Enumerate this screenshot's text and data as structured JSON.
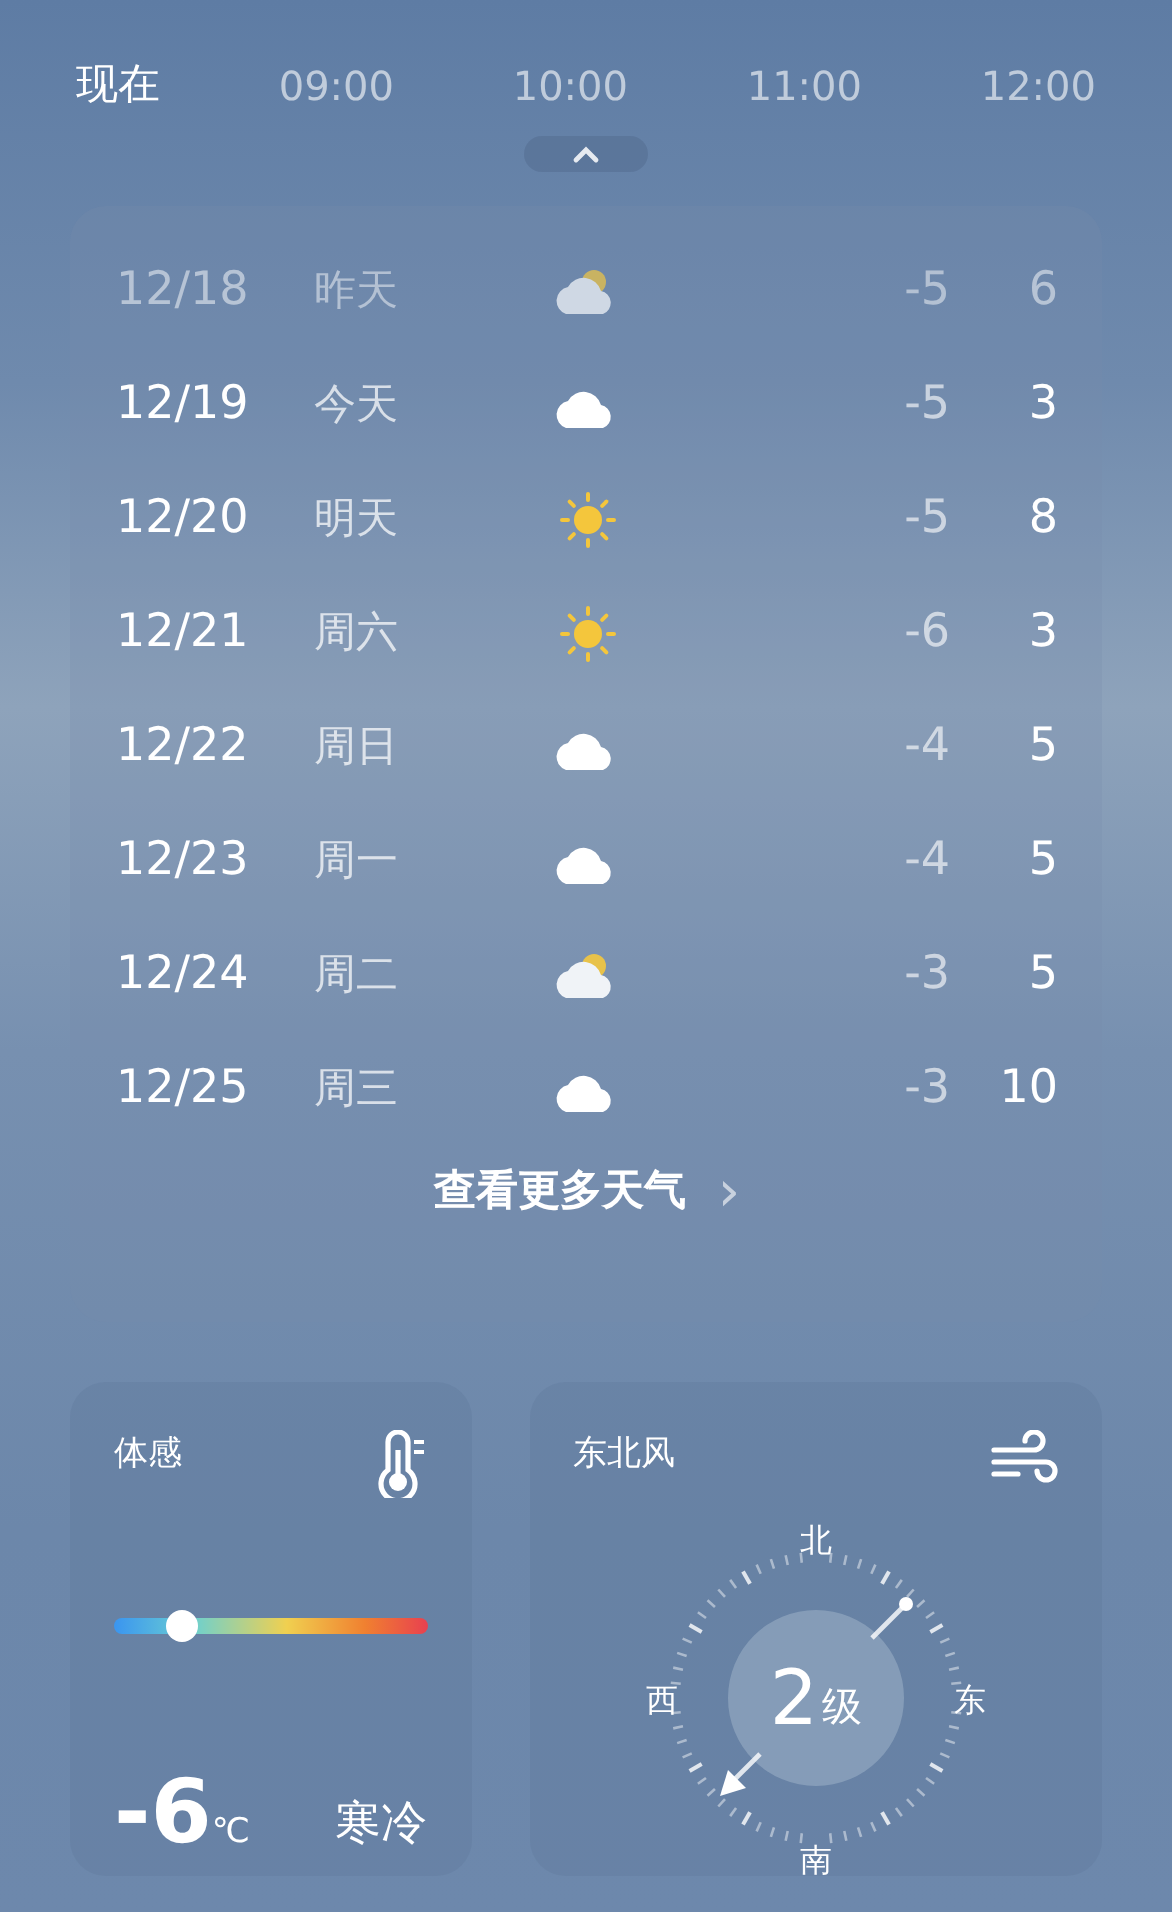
{
  "hourly": [
    {
      "label": "现在",
      "selected": true
    },
    {
      "label": "09:00",
      "selected": false
    },
    {
      "label": "10:00",
      "selected": false
    },
    {
      "label": "11:00",
      "selected": false
    },
    {
      "label": "12:00",
      "selected": false
    }
  ],
  "expand_handle": {
    "expanded": false
  },
  "forecast": [
    {
      "date": "12/18",
      "day": "昨天",
      "kind": "partly",
      "low": "-5",
      "high": "6",
      "past": true
    },
    {
      "date": "12/19",
      "day": "今天",
      "kind": "cloudy",
      "low": "-5",
      "high": "3",
      "past": false
    },
    {
      "date": "12/20",
      "day": "明天",
      "kind": "sunny",
      "low": "-5",
      "high": "8",
      "past": false
    },
    {
      "date": "12/21",
      "day": "周六",
      "kind": "sunny",
      "low": "-6",
      "high": "3",
      "past": false
    },
    {
      "date": "12/22",
      "day": "周日",
      "kind": "cloudy",
      "low": "-4",
      "high": "5",
      "past": false
    },
    {
      "date": "12/23",
      "day": "周一",
      "kind": "cloudy",
      "low": "-4",
      "high": "5",
      "past": false
    },
    {
      "date": "12/24",
      "day": "周二",
      "kind": "partly",
      "low": "-3",
      "high": "5",
      "past": false
    },
    {
      "date": "12/25",
      "day": "周三",
      "kind": "cloudy",
      "low": "-3",
      "high": "10",
      "past": false
    }
  ],
  "more_link": {
    "label": "查看更多天气",
    "arrow": "›"
  },
  "feels_like": {
    "title": "体感",
    "level": 0.22,
    "value": "-6",
    "unit": "℃",
    "description": "寒冷"
  },
  "wind": {
    "title": "东北风",
    "north": "北",
    "east": "东",
    "south": "南",
    "west": "西",
    "force": "2",
    "unit": "级"
  }
}
